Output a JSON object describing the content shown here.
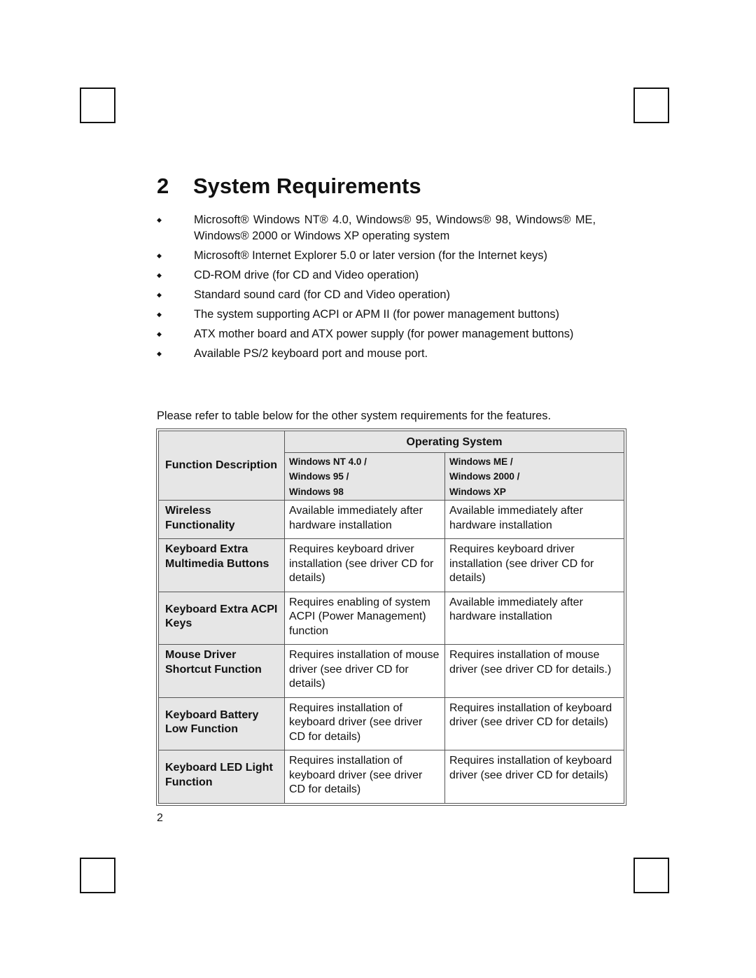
{
  "section": {
    "number": "2",
    "title": "System Requirements"
  },
  "requirements": [
    "Microsoft® Windows NT® 4.0, Windows® 95, Windows® 98, Windows® ME, Windows® 2000 or Windows XP operating system",
    "Microsoft® Internet Explorer 5.0 or later version (for the Internet keys)",
    "CD-ROM drive (for CD and Video operation)",
    "Standard sound card (for CD and Video operation)",
    "The system supporting ACPI or APM II (for power management buttons)",
    "ATX mother board and ATX power supply (for power management buttons)",
    "Available PS/2 keyboard port and mouse port."
  ],
  "bullet_glyph": "◆",
  "intro": "Please refer to table below for the other system requirements for the features.",
  "table": {
    "function_header": "Function Description",
    "os_header": "Operating System",
    "os_columns": [
      [
        "Windows NT 4.0 /",
        "Windows 95 /",
        "Windows 98"
      ],
      [
        "Windows ME /",
        "Windows 2000 /",
        "Windows XP"
      ]
    ],
    "rows": [
      {
        "function": "Wireless Functionality",
        "col1": "Available immediately after hardware installation",
        "col2": "Available immediately after hardware installation"
      },
      {
        "function": "Keyboard Extra Multimedia Buttons",
        "col1": "Requires keyboard driver installation (see driver CD for details)",
        "col2": "Requires keyboard driver installation (see driver CD for details)"
      },
      {
        "function": "Keyboard Extra ACPI Keys",
        "col1": "Requires enabling of system ACPI (Power Management) function",
        "col2": "Available immediately after hardware installation"
      },
      {
        "function": "Mouse Driver Shortcut Function",
        "col1": "Requires installation of mouse driver (see driver CD for details)",
        "col2": "Requires installation of mouse driver (see driver CD for details.)"
      },
      {
        "function": "Keyboard Battery Low Function",
        "col1": "Requires installation of keyboard driver (see driver CD for details)",
        "col2": "Requires installation of keyboard driver (see driver CD for details)"
      },
      {
        "function": "Keyboard LED Light Function",
        "col1": "Requires installation of keyboard driver (see driver CD for details)",
        "col2": "Requires installation of keyboard driver (see driver CD for details)"
      }
    ]
  },
  "page_number": "2"
}
